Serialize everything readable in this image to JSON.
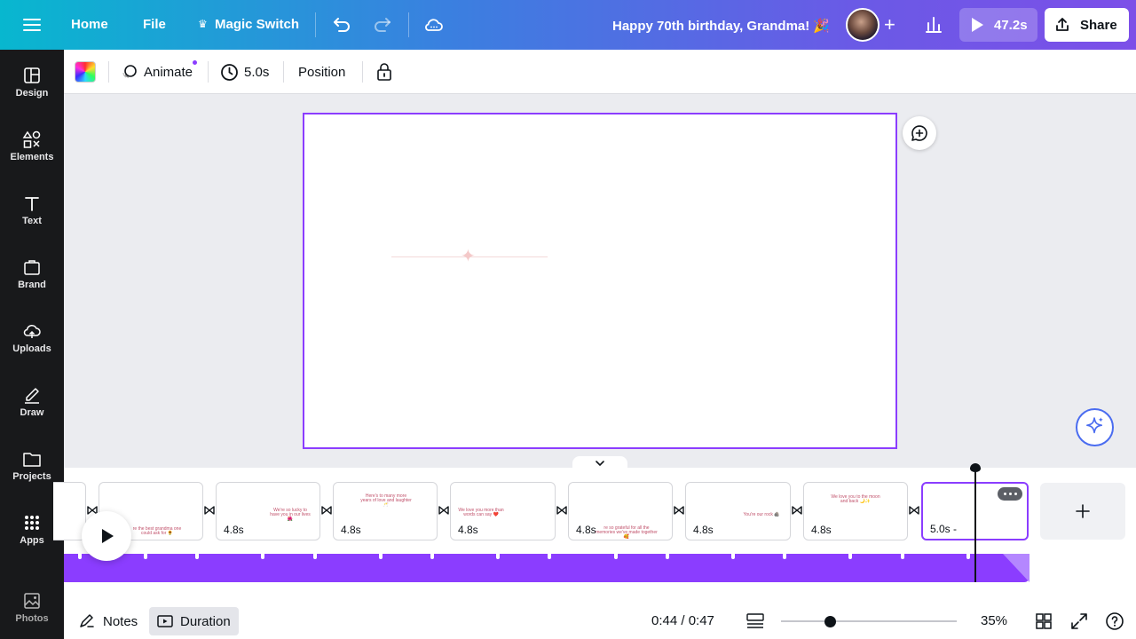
{
  "topbar": {
    "home": "Home",
    "file": "File",
    "magic_switch": "Magic Switch",
    "doc_title": "Happy 70th birthday, Grandma! 🎉",
    "play_duration": "47.2s",
    "share": "Share"
  },
  "sidebar": {
    "items": [
      {
        "label": "Design",
        "icon": "design-icon"
      },
      {
        "label": "Elements",
        "icon": "elements-icon"
      },
      {
        "label": "Text",
        "icon": "text-icon"
      },
      {
        "label": "Brand",
        "icon": "brand-icon"
      },
      {
        "label": "Uploads",
        "icon": "uploads-icon"
      },
      {
        "label": "Draw",
        "icon": "draw-icon"
      },
      {
        "label": "Projects",
        "icon": "projects-icon"
      },
      {
        "label": "Apps",
        "icon": "apps-icon"
      },
      {
        "label": "Photos",
        "icon": "photos-icon"
      }
    ]
  },
  "toolbar": {
    "animate": "Animate",
    "duration": "5.0s",
    "position": "Position"
  },
  "timeline": {
    "clips": [
      {
        "duration": "",
        "thumb": ""
      },
      {
        "duration": "",
        "thumb": "re the best grandma one could ask for 🌻"
      },
      {
        "duration": "4.8s",
        "thumb": "We're so lucky to have you in our lives 🌺"
      },
      {
        "duration": "4.8s",
        "thumb": "Here's to many more years of love and laughter 🥂"
      },
      {
        "duration": "4.8s",
        "thumb": "We love you more than words can say ❤️"
      },
      {
        "duration": "4.8s",
        "thumb": "re so grateful for all the memories we've made together 🥰"
      },
      {
        "duration": "4.8s",
        "thumb": "You're our rock 🪨"
      },
      {
        "duration": "4.8s",
        "thumb": "We love you to the moon and back 🌙✨"
      },
      {
        "duration": "5.0s -",
        "thumb": ""
      }
    ]
  },
  "bottombar": {
    "notes": "Notes",
    "duration": "Duration",
    "timecode": "0:44 / 0:47",
    "zoom": "35%",
    "zoom_level": 0.28
  },
  "colors": {
    "accent": "#8b3dff",
    "sidebar_bg": "#18191b",
    "canvas_bg": "#ebecf0"
  }
}
